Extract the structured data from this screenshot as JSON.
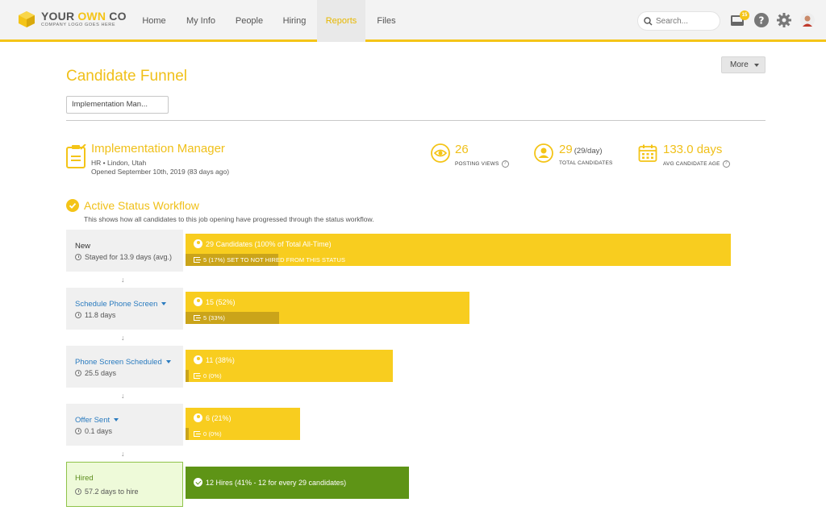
{
  "nav": {
    "logo_name_prefix": "YOUR ",
    "logo_name_highlight": "OWN",
    "logo_name_suffix": " CO",
    "logo_tagline": "COMPANY LOGO GOES HERE",
    "items": [
      {
        "label": "Home"
      },
      {
        "label": "My Info"
      },
      {
        "label": "People"
      },
      {
        "label": "Hiring"
      },
      {
        "label": "Reports"
      },
      {
        "label": "Files"
      }
    ],
    "active_item": "Reports",
    "search_placeholder": "Search...",
    "inbox_badge": "15",
    "icons": [
      "search-icon",
      "inbox-icon",
      "help-icon",
      "settings-gear-icon",
      "user-avatar"
    ]
  },
  "header": {
    "title": "Candidate Funnel",
    "more_label": "More",
    "job_select_value": "Implementation Man..."
  },
  "job": {
    "title": "Implementation Manager",
    "meta": "HR • Lindon, Utah",
    "opened": "Opened September 10th, 2019 (83 days ago)"
  },
  "stats": [
    {
      "value": "26",
      "sub": "",
      "label": "POSTING VIEWS",
      "icon": "eye-icon"
    },
    {
      "value": "29",
      "sub": "(29/day)",
      "label": "TOTAL CANDIDATES",
      "icon": "person-icon"
    },
    {
      "value": "133.0 days",
      "sub": "",
      "label": "AVG CANDIDATE AGE",
      "icon": "calendar-icon"
    }
  ],
  "workflow": {
    "title": "Active Status Workflow",
    "description": "This shows how all candidates to this job opening have progressed through the status workflow.",
    "stages": [
      {
        "name": "New",
        "time": "Stayed for 13.9 days (avg.)",
        "bar_label": "29 Candidates (100% of Total All-Time)",
        "bar_fraction": 1.0,
        "exit_label": "5 (17%) SET TO NOT HIRED FROM THIS STATUS",
        "exit_fraction": 0.17
      },
      {
        "name": "Schedule Phone Screen",
        "time": "11.8 days",
        "bar_label": "15 (52%)",
        "bar_fraction": 0.52,
        "exit_label": "5 (33%)",
        "exit_fraction": 0.33
      },
      {
        "name": "Phone Screen Scheduled",
        "time": "25.5 days",
        "bar_label": "11 (38%)",
        "bar_fraction": 0.38,
        "exit_label": "0 (0%)",
        "exit_fraction": 0.0
      },
      {
        "name": "Offer Sent",
        "time": "0.1 days",
        "bar_label": "6 (21%)",
        "bar_fraction": 0.21,
        "exit_label": "0 (0%)",
        "exit_fraction": 0.0
      }
    ],
    "hired": {
      "name": "Hired",
      "time": "57.2 days to hire",
      "bar_label": "12 Hires (41% - 12 for every 29 candidates)",
      "bar_fraction": 0.41
    }
  },
  "colors": {
    "accent": "#f4c417",
    "bar": "#f8cd1f",
    "bar_dark": "#caa41a",
    "hired": "#5e9416",
    "link": "#2a7bbf"
  }
}
